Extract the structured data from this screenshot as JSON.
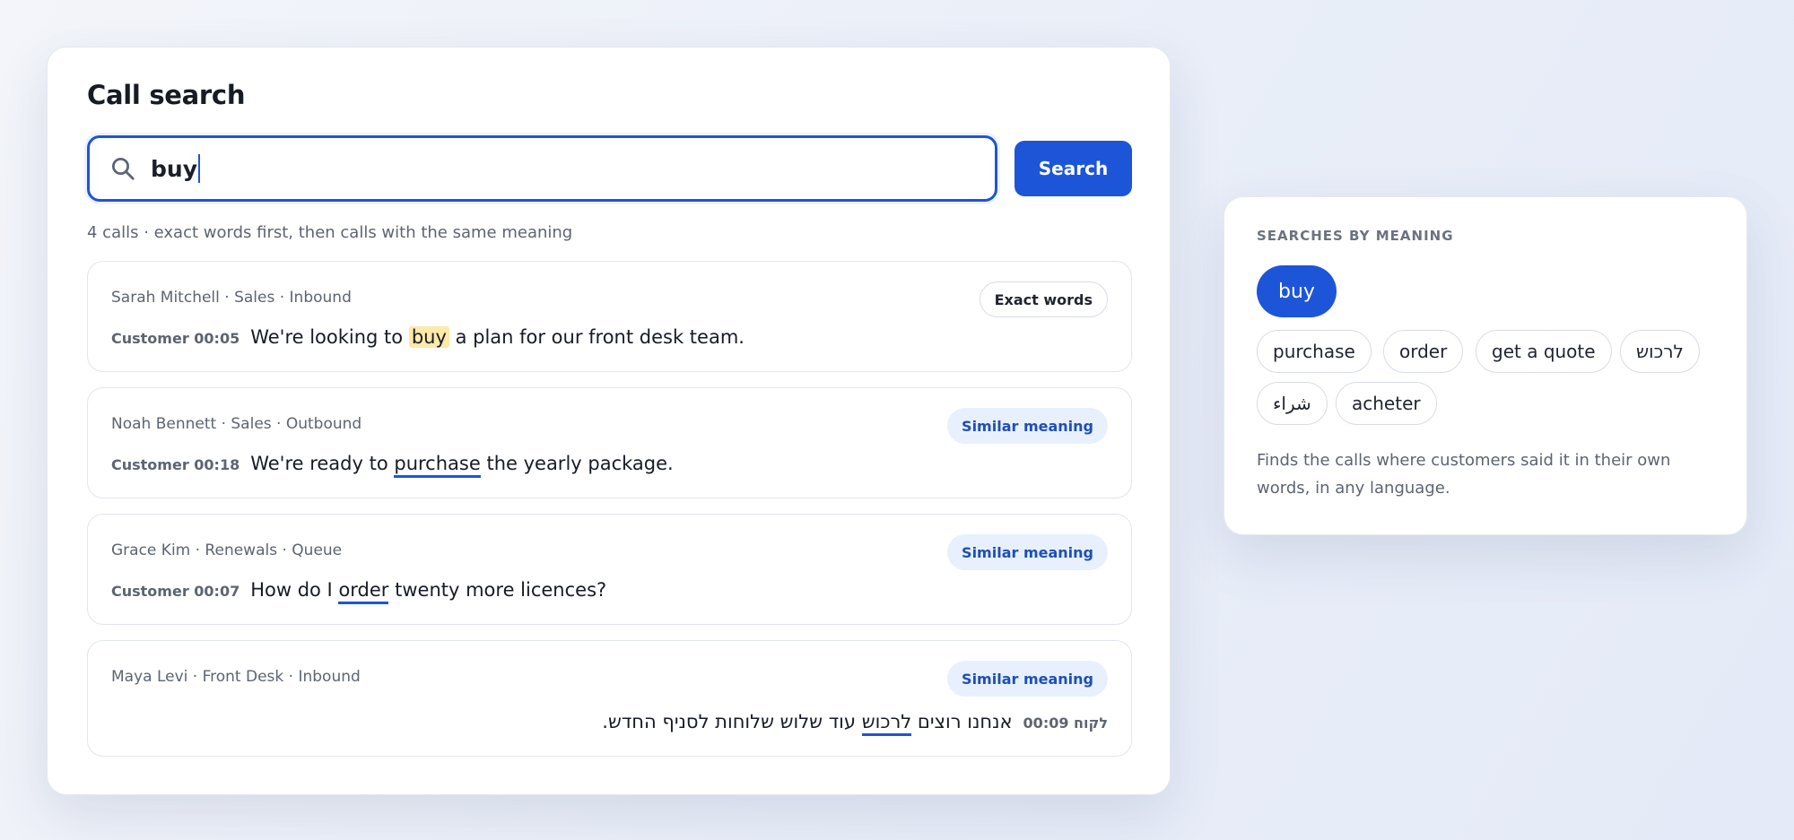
{
  "header": {
    "title": "Call search"
  },
  "search": {
    "query": "buy",
    "button_label": "Search"
  },
  "results": {
    "summary": "4 calls · exact words first, then calls with the same meaning",
    "items": [
      {
        "meta": "Sarah Mitchell · Sales · Inbound",
        "badge": "Exact words",
        "speaker": "Customer 00:05",
        "before": "We're looking to ",
        "match": "buy",
        "after": " a plan for our front desk team."
      },
      {
        "meta": "Noah Bennett · Sales · Outbound",
        "badge": "Similar meaning",
        "speaker": "Customer 00:18",
        "before": "We're ready to ",
        "match": "purchase",
        "after": " the yearly package."
      },
      {
        "meta": "Grace Kim · Renewals · Queue",
        "badge": "Similar meaning",
        "speaker": "Customer 00:07",
        "before": "How do I ",
        "match": "order",
        "after": " twenty more licences?"
      },
      {
        "meta": "Maya Levi · Front Desk · Inbound",
        "badge": "Similar meaning",
        "speaker": "לקוח 00:09",
        "before": "אנחנו רוצים ",
        "match": "לרכוש",
        "after": " עוד שלוש שלוחות לסניף החדש."
      }
    ]
  },
  "meaning_panel": {
    "heading": "SEARCHES BY MEANING",
    "active": "buy",
    "chips": [
      "purchase",
      "order",
      "get a quote",
      "לרכוש",
      "شراء",
      "acheter"
    ],
    "description": "Finds the calls where customers said it in their own words, in any language."
  },
  "colors": {
    "accent": "#1d55d9",
    "exact_highlight": "#fde9a8",
    "similar_badge_bg": "#e8f0fd"
  },
  "icons": {
    "search": "search-icon"
  }
}
